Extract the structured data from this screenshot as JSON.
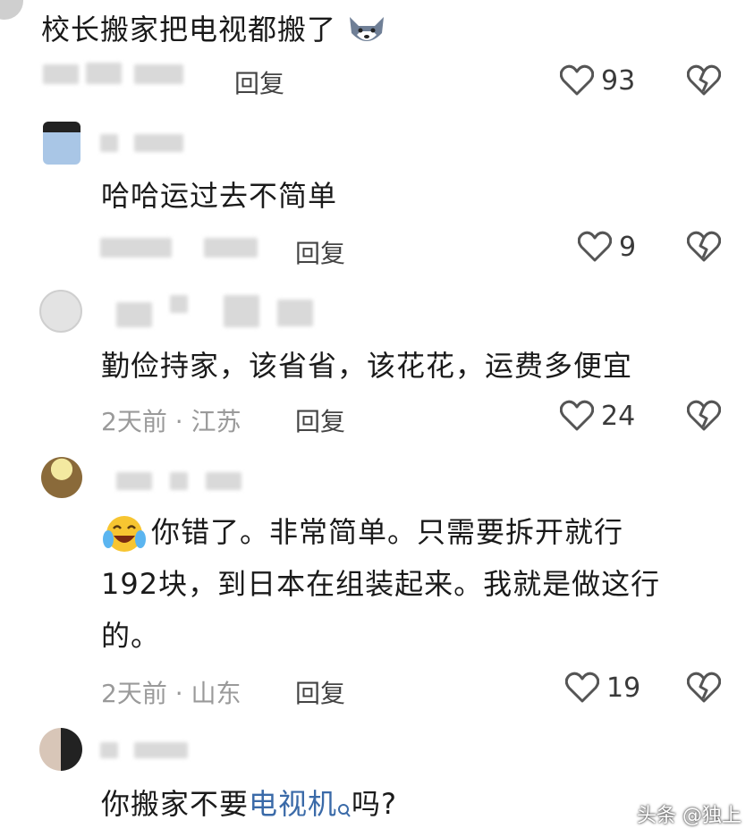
{
  "comments": [
    {
      "text": "校长搬家把电视都搬了",
      "reply": "回复",
      "likes": "93"
    },
    {
      "text": "哈哈运过去不简单",
      "reply": "回复",
      "likes": "9"
    },
    {
      "text": "勤俭持家，该省省，该花花，运费多便宜",
      "meta": "2天前 · 江苏",
      "reply": "回复",
      "likes": "24"
    },
    {
      "line1": "你错了。非常简单。只需要拆开就行",
      "line2": "192块，到日本在组装起来。我就是做这行",
      "line3": "的。",
      "meta": "2天前 · 山东",
      "reply": "回复",
      "likes": "19",
      "emoji": "laughing-tears-emoji"
    },
    {
      "before": "你搬家不要",
      "link": "电视机",
      "after": "吗?"
    }
  ],
  "watermark": "头条 @独上",
  "colors": {
    "link": "#3a6aa8",
    "meta": "#9a9a9a",
    "heart": "#555555"
  }
}
